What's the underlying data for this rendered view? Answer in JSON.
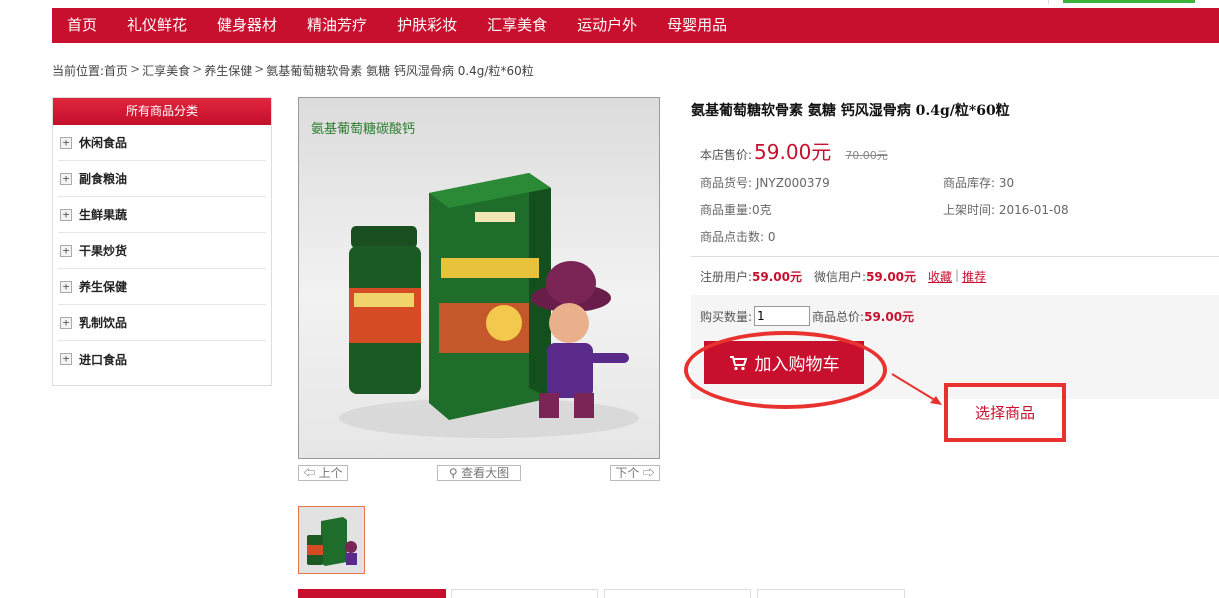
{
  "nav": [
    "首页",
    "礼仪鲜花",
    "健身器材",
    "精油芳疗",
    "护肤彩妆",
    "汇享美食",
    "运动户外",
    "母婴用品"
  ],
  "breadcrumb": {
    "prefix": "当前位置:",
    "items": [
      "首页",
      "汇享美食",
      "养生保健",
      "氨基葡萄糖软骨素 氨糖 钙风湿骨病 0.4g/粒*60粒"
    ],
    "separator": ">"
  },
  "sidebar": {
    "title": "所有商品分类",
    "items": [
      "休闲食品",
      "副食粮油",
      "生鲜果蔬",
      "干果炒货",
      "养生保健",
      "乳制饮品",
      "进口食品"
    ]
  },
  "gallery": {
    "image_caption": "氨基葡萄糖碳酸钙",
    "prev_label": "上个",
    "zoom_label": "查看大图",
    "next_label": "下个"
  },
  "product": {
    "title": "氨基葡萄糖软骨素 氨糖 钙风湿骨病 0.4g/粒*60粒",
    "price_label": "本店售价:",
    "price": "59.00元",
    "market_price": "70.00元",
    "sku_label": "商品货号:",
    "sku": "JNYZ000379",
    "stock_label": "商品库存:",
    "stock": "30",
    "weight_label": "商品重量:",
    "weight": "0克",
    "listed_label": "上架时间:",
    "listed": "2016-01-08",
    "clicks_label": "商品点击数:",
    "clicks": "0",
    "member_label": "注册用户:",
    "member_price": "59.00元",
    "wechat_label": "微信用户:",
    "wechat_price": "59.00元",
    "favorite": "收藏",
    "link_sep": "|",
    "recommend": "推荐",
    "qty_label": "购买数量:",
    "qty": "1",
    "total_label": "商品总价:",
    "total": "59.00元",
    "cart_button": "加入购物车"
  },
  "annotation": {
    "text": "选择商品",
    "color": "#e8322f"
  },
  "colors": {
    "brand": "#c8102e"
  }
}
